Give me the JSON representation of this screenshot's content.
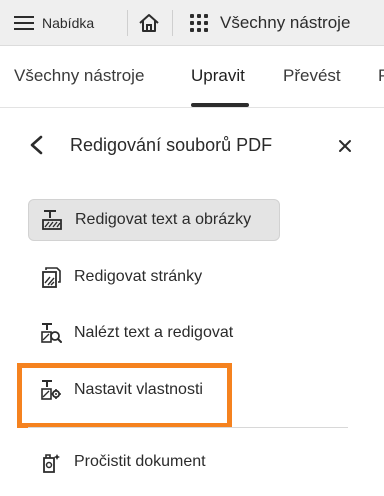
{
  "topbar": {
    "menu_label": "Nabídka",
    "all_tools_label": "Všechny nástroje"
  },
  "tabs": [
    {
      "label": "Všechny nástroje"
    },
    {
      "label": "Upravit",
      "active": true
    },
    {
      "label": "Převést"
    },
    {
      "label": "P"
    }
  ],
  "panel": {
    "title": "Redigování souborů PDF",
    "items": [
      {
        "label": "Redigovat text a obrázky",
        "icon": "redact-text-image-icon",
        "selected": true
      },
      {
        "label": "Redigovat stránky",
        "icon": "redact-pages-icon"
      },
      {
        "label": "Nalézt text a redigovat",
        "icon": "find-redact-icon"
      },
      {
        "label": "Nastavit vlastnosti",
        "icon": "redaction-properties-icon",
        "highlighted": true
      },
      {
        "label": "Pročistit dokument",
        "icon": "sanitize-document-icon"
      }
    ]
  },
  "colors": {
    "highlight": "#f5821f",
    "topbar_bg": "#efefef",
    "selected_bg": "#e4e4e4"
  }
}
